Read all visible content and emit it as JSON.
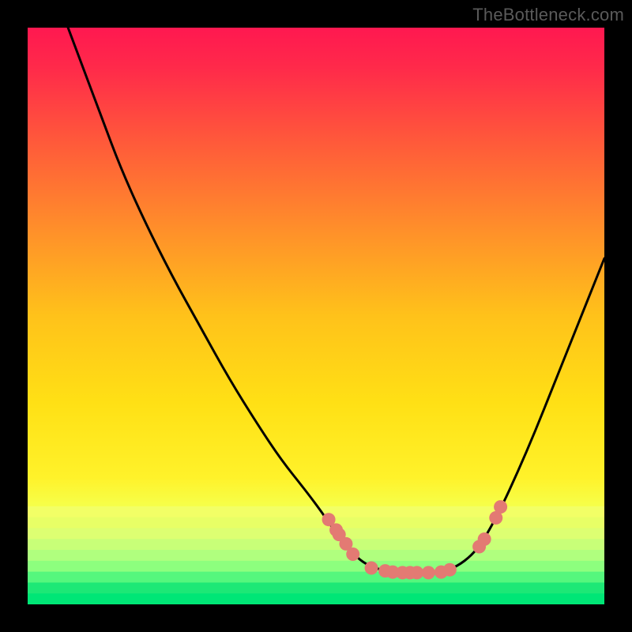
{
  "watermark": "TheBottleneck.com",
  "chart_data": {
    "type": "line",
    "title": "",
    "xlabel": "",
    "ylabel": "",
    "xlim": [
      0,
      100
    ],
    "ylim": [
      0,
      100
    ],
    "background_gradient": {
      "top_color": "#ff1a4a",
      "mid_color": "#ffd600",
      "low_color": "#d7ff5a",
      "bottom_color": "#00e676"
    },
    "bottom_band": {
      "y_start": 83,
      "y_end": 100,
      "stripes": [
        "#f2ff66",
        "#e8ff66",
        "#ddff72",
        "#c8ff78",
        "#b0ff7e",
        "#8dff7e",
        "#55f77d",
        "#1de876",
        "#00e676"
      ]
    },
    "curve": {
      "points": [
        [
          7,
          0
        ],
        [
          10,
          8
        ],
        [
          13,
          16
        ],
        [
          16,
          24
        ],
        [
          20,
          33
        ],
        [
          25,
          43
        ],
        [
          30,
          52
        ],
        [
          35,
          61
        ],
        [
          40,
          69
        ],
        [
          44,
          75
        ],
        [
          48,
          80
        ],
        [
          51,
          84
        ],
        [
          53,
          87
        ],
        [
          55.5,
          90
        ],
        [
          57.5,
          92.3
        ],
        [
          60,
          93.7
        ],
        [
          63,
          94.3
        ],
        [
          66,
          94.5
        ],
        [
          69,
          94.5
        ],
        [
          72,
          94.3
        ],
        [
          74.5,
          93.4
        ],
        [
          77,
          91.5
        ],
        [
          79,
          89
        ],
        [
          82,
          83.5
        ],
        [
          85,
          77
        ],
        [
          88,
          70
        ],
        [
          91,
          62.5
        ],
        [
          94,
          55
        ],
        [
          97,
          47.5
        ],
        [
          100,
          40
        ]
      ]
    },
    "dots": {
      "color": "#e37a73",
      "radius": 8.5,
      "points": [
        [
          52.2,
          85.3
        ],
        [
          53.5,
          87.1
        ],
        [
          54.0,
          87.9
        ],
        [
          55.2,
          89.5
        ],
        [
          56.4,
          91.3
        ],
        [
          59.6,
          93.7
        ],
        [
          62.0,
          94.2
        ],
        [
          63.3,
          94.4
        ],
        [
          65.0,
          94.5
        ],
        [
          66.3,
          94.5
        ],
        [
          67.5,
          94.5
        ],
        [
          69.5,
          94.5
        ],
        [
          71.7,
          94.4
        ],
        [
          73.2,
          94.0
        ],
        [
          78.3,
          90.0
        ],
        [
          79.2,
          88.7
        ],
        [
          81.2,
          85.0
        ],
        [
          82.0,
          83.1
        ]
      ]
    }
  }
}
